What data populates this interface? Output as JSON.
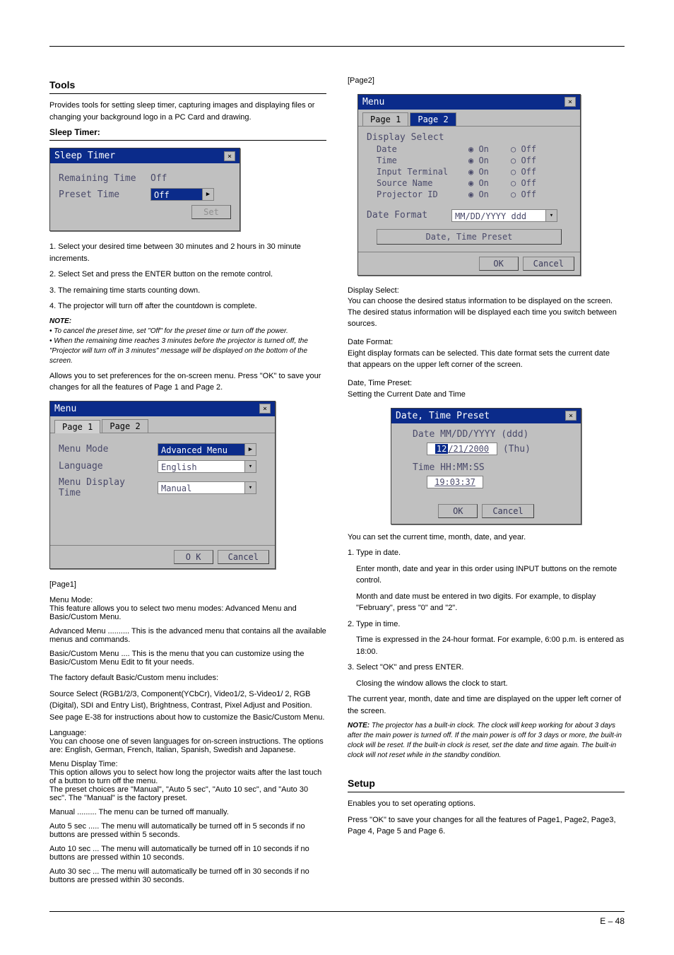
{
  "page": {
    "top_number": "E – 48",
    "footer": "E – 48"
  },
  "left": {
    "tools_heading": "Tools",
    "tools_intro": "Provides tools for setting sleep timer, capturing images and displaying files or changing your background logo in a PC Card and drawing.",
    "sleep_title": "Sleep Timer:",
    "sleep_steps": [
      "1. Select your desired time between 30 minutes and 2 hours in 30 minute increments.",
      "2. Select Set and press the ENTER button on the remote control.",
      "3. The remaining time starts counting down.",
      "4. The projector will turn off after the countdown is complete."
    ],
    "sleep_note_label": "NOTE:",
    "sleep_notes": [
      "• To cancel the preset time, set \"Off\" for the preset time or turn off the power.",
      "• When the remaining time reaches 3 minutes before the projector is turned off, the \"Projector will turn off in 3 minutes\" message will be displayed on the bottom of the screen."
    ],
    "menu_intro": "Allows you to set preferences for the on-screen menu. Press \"OK\" to save your changes for all the features of Page 1 and Page 2.",
    "page1_heading": "[Page1]",
    "menu_mode_heading": "Menu Mode:",
    "menu_mode_text": "This feature allows you to select two menu modes: Advanced Menu and Basic/Custom Menu.",
    "adv_menu_label": "Advanced Menu ..........",
    "adv_menu_text": "This is the advanced menu that contains all the available menus and commands.",
    "basic_menu_label": "Basic/Custom Menu ....",
    "basic_menu_text": "This is the menu that you can customize using the Basic/Custom Menu Edit to fit your needs.",
    "factory_intro": "The factory default Basic/Custom menu includes:",
    "factory_items": "Source Select (RGB1/2/3, Component(YCbCr), Video1/2, S-Video1/ 2, RGB (Digital), SDI and Entry List), Brightness, Contrast, Pixel Adjust and Position. See page E-38 for instructions about how to customize the Basic/Custom Menu.",
    "lang_heading": "Language:",
    "lang_text": "You can choose one of seven languages for on-screen instructions. The options are: English, German, French, Italian, Spanish, Swedish and Japanese.",
    "disp_time_heading": "Menu Display Time:",
    "disp_time_text": "This option allows you to select how long the projector waits after the last touch of a button to turn off the menu.",
    "disp_time_text2": "The preset choices are \"Manual\", \"Auto 5 sec\", \"Auto 10 sec\", and \"Auto 30 sec\". The \"Manual\" is the factory preset.",
    "disp_time_items": {
      "manual_lbl": "Manual .........",
      "manual_txt": "The menu can be turned off manually.",
      "a5_lbl": "Auto 5 sec .....",
      "a5_txt": "The menu will automatically be turned off in 5 seconds if no buttons are pressed within 5 seconds.",
      "a10_lbl": "Auto 10 sec ...",
      "a10_txt": "The menu will automatically be turned off in 10 seconds if no buttons are pressed within 10 seconds.",
      "a30_lbl": "Auto 30 sec ...",
      "a30_txt": "The menu will automatically be turned off in 30 seconds if no buttons are pressed within 30 seconds."
    }
  },
  "right": {
    "page2_heading": "[Page2]",
    "display_select_heading": "Display Select:",
    "display_select_text": "You can choose the desired status information to be displayed on the screen. The desired status information will be displayed each time you switch between sources.",
    "date_format_heading": "Date Format:",
    "date_format_text": "Eight display formats can be selected. This date format sets the current date that appears on the upper left corner of the screen.",
    "dtp_heading": "Date, Time Preset:",
    "dtp_text": "Setting the Current Date and Time",
    "dtp_para1": "You can set the current time, month, date, and year.",
    "dtp_steps": [
      "1. Type in date.",
      "   Enter month, date and year in this order using INPUT buttons on the remote control.",
      "   Month and date must be entered in two digits. For example, to display \"February\", press \"0\" and \"2\".",
      "2. Type in time.",
      "   Time is expressed in the 24-hour format. For example, 6:00 p.m. is entered as 18:00.",
      "3. Select \"OK\" and press ENTER.",
      "   Closing the window allows the clock to start."
    ],
    "dtp_close": "The current year, month, date and time are displayed on the upper left corner of the screen.",
    "dtp_note_label": "NOTE:",
    "dtp_note": "The projector has a built-in clock. The clock will keep working for about 3 days after the main power is turned off. If the main power is off for 3 days or more, the built-in clock will be reset. If the built-in clock is reset, set the date and time again. The built-in clock will not reset while in the standby condition.",
    "setup_heading": "Setup",
    "setup_intro": "Enables you to set operating options.",
    "setup_close": "Press \"OK\" to save your changes for all the features of Page1, Page2, Page3, Page 4, Page 5 and Page 6."
  },
  "sleep_dialog": {
    "title": "Sleep Timer",
    "remaining_label": "Remaining Time",
    "remaining_value": "Off",
    "preset_label": "Preset Time",
    "preset_value": "Off",
    "set_btn": "Set"
  },
  "menu_dialog": {
    "title": "Menu",
    "tab1": "Page 1",
    "tab2": "Page 2",
    "menu_mode_label": "Menu Mode",
    "menu_mode_value": "Advanced Menu",
    "language_label": "Language",
    "language_value": "English",
    "disp_time_label": "Menu Display Time",
    "disp_time_value": "Manual",
    "ok": "O K",
    "cancel": "Cancel"
  },
  "menu2_dialog": {
    "title": "Menu",
    "tab1": "Page 1",
    "tab2": "Page 2",
    "display_select": "Display Select",
    "rows": [
      "Date",
      "Time",
      "Input Terminal",
      "Source Name",
      "Projector ID"
    ],
    "on": "On",
    "off": "Off",
    "date_format_label": "Date Format",
    "date_format_value": "MM/DD/YYYY ddd",
    "dtp_btn": "Date, Time Preset",
    "ok": "OK",
    "cancel": "Cancel"
  },
  "dtp_dialog": {
    "title": "Date, Time Preset",
    "date_label": "Date   MM/DD/YYYY (ddd)",
    "date_mm": "12",
    "date_rest": "/21/2000",
    "date_dow": "(Thu)",
    "time_label": "Time   HH:MM:SS",
    "time_value": "19:03:37",
    "ok": "OK",
    "cancel": "Cancel"
  }
}
